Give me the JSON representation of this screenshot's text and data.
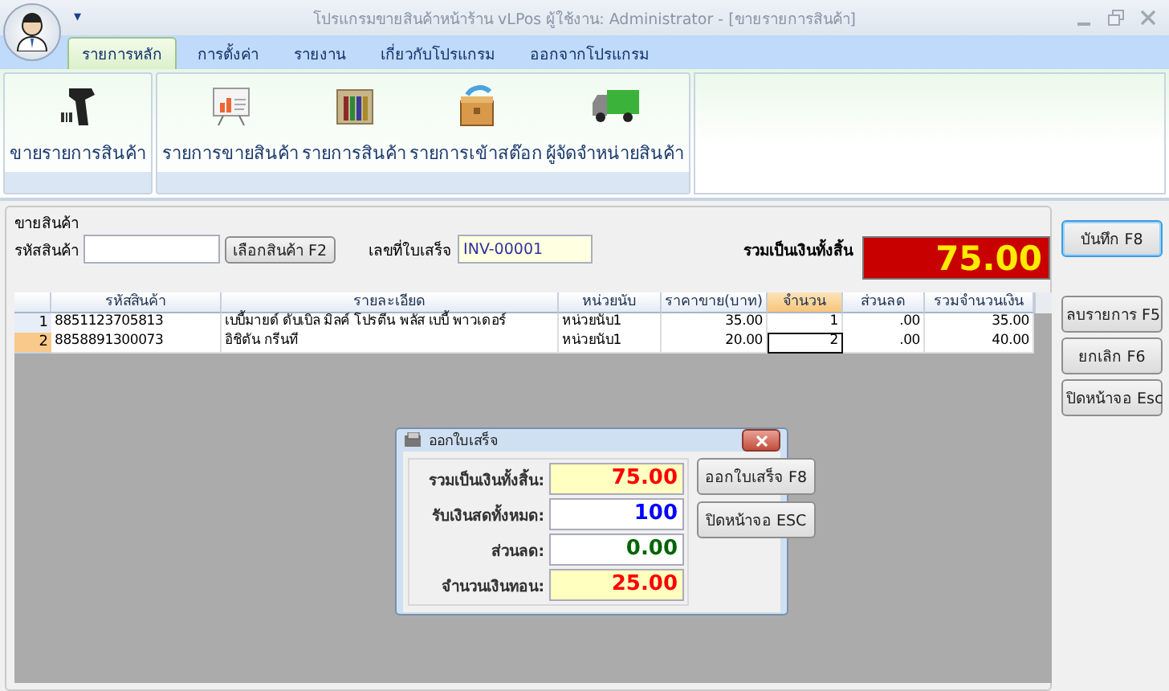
{
  "window": {
    "title": "โปรแกรมขายสินค้าหน้าร้าน vLPos ผู้ใช้งาน: Administrator - [ขายรายการสินค้า]",
    "quick_access": "▾"
  },
  "tabs": [
    {
      "label": "รายการหลัก",
      "selected": true
    },
    {
      "label": "การตั้งค่า",
      "selected": false
    },
    {
      "label": "รายงาน",
      "selected": false
    },
    {
      "label": "เกี่ยวกับโปรแกรม",
      "selected": false
    },
    {
      "label": "ออกจากโปรแกรม",
      "selected": false
    }
  ],
  "ribbon": {
    "groups": [
      {
        "items": [
          {
            "label": "ขายรายการสินค้า",
            "kind": "scanner"
          }
        ]
      },
      {
        "items": [
          {
            "label": "รายการขายสินค้า",
            "kind": "chart"
          },
          {
            "label": "รายการสินค้า",
            "kind": "binders"
          },
          {
            "label": "รายการเข้าสต๊อก",
            "kind": "crate"
          },
          {
            "label": "ผู้จัดจำหน่ายสินค้า",
            "kind": "truck"
          }
        ]
      }
    ]
  },
  "sale": {
    "group_label": "ขายสินค้า",
    "product_code_label": "รหัสสินค้า",
    "select_button": "เลือกสินค้า F2",
    "receipt_label": "เลขที่ใบเสร็จ",
    "receipt_value": "INV-00001",
    "total_label": "รวมเป็นเงินทั้งสิ้น",
    "total_value": "75.00"
  },
  "table": {
    "columns": [
      {
        "label": "รหัสสินค้า",
        "selected": false
      },
      {
        "label": "รายละเอียด",
        "selected": false
      },
      {
        "label": "หน่วยนับ",
        "selected": false
      },
      {
        "label": "ราคาขาย(บาท)",
        "selected": false
      },
      {
        "label": "จำนวน",
        "selected": true
      },
      {
        "label": "ส่วนลด",
        "selected": false
      },
      {
        "label": "รวมจำนวนเงิน",
        "selected": false
      }
    ],
    "rows": [
      {
        "number": "1",
        "selected": false,
        "cells": [
          "8851123705813",
          "เบบี้มายด์ ดับเบิล มิลค์ โปรตีน พลัส เบบี้ พาวเดอร์",
          "หน่วยนับ1",
          "35.00",
          "1",
          ".00",
          "35.00"
        ]
      },
      {
        "number": "2",
        "selected": true,
        "cells": [
          "8858891300073",
          "อิชิตัน กรีนที",
          "หน่วยนับ1",
          "20.00",
          "2",
          ".00",
          "40.00"
        ]
      }
    ]
  },
  "side_buttons": [
    {
      "label": "บันทึก F8",
      "default": true
    },
    {
      "label": "ลบรายการ F5",
      "default": false
    },
    {
      "label": "ยกเลิก F6",
      "default": false
    },
    {
      "label": "ปิดหน้าจอ Esc",
      "default": false
    }
  ],
  "dialog": {
    "title": "ออกใบเสร็จ",
    "fields": [
      {
        "label": "รวมเป็นเงินทั้งสิ้น:",
        "value": "75.00",
        "color": "#ff0000",
        "highlighted": true
      },
      {
        "label": "รับเงินสดทั้งหมด:",
        "value": "100",
        "color": "#0000ff",
        "highlighted": false
      },
      {
        "label": "ส่วนลด:",
        "value": "0.00",
        "color": "#006400",
        "highlighted": false
      },
      {
        "label": "จำนวนเงินทอน:",
        "value": "25.00",
        "color": "#ff0000",
        "highlighted": true
      }
    ],
    "buttons": [
      "ออกใบเสร็จ F8",
      "ปิดหน้าจอ ESC"
    ]
  }
}
